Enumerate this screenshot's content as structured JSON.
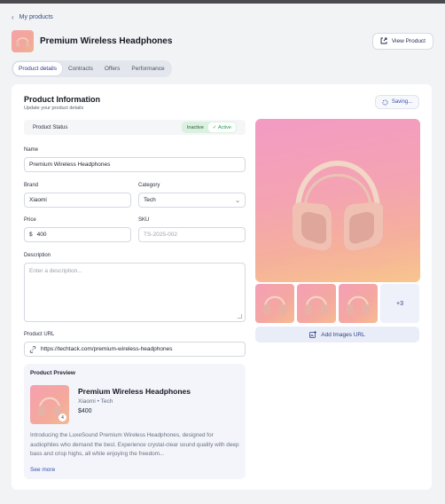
{
  "nav": {
    "back_label": "My products"
  },
  "header": {
    "title": "Premium Wireless Headphones",
    "view_button": "View Product"
  },
  "tabs": [
    {
      "label": "Product details",
      "active": true
    },
    {
      "label": "Contracts",
      "active": false
    },
    {
      "label": "Offers",
      "active": false
    },
    {
      "label": "Performance",
      "active": false
    }
  ],
  "info": {
    "title": "Product Information",
    "subtitle": "Update your product details",
    "saving_label": "Saving..."
  },
  "status": {
    "label": "Product Status",
    "inactive": "Inactive",
    "active": "Active",
    "selected": "Active"
  },
  "form": {
    "name_label": "Name",
    "name_value": "Premium Wireless Headphones",
    "brand_label": "Brand",
    "brand_value": "Xiaomi",
    "category_label": "Category",
    "category_value": "Tech",
    "price_label": "Price",
    "price_currency": "$",
    "price_value": "400",
    "sku_label": "SKU",
    "sku_placeholder": "TS-2025-002",
    "description_label": "Description",
    "description_placeholder": "Enter a description...",
    "url_label": "Product URL",
    "url_value": "https://techtack.com/premium-wireless-headphones"
  },
  "preview": {
    "title": "Product Preview",
    "name": "Premium Wireless Headphones",
    "meta": "Xiaomi • Tech",
    "price": "$400",
    "image_count": "4",
    "description": "Introducing the LuxeSound Premium Wireless Headphones, designed for audiophiles who demand the best. Experience crystal-clear sound quality with deep bass and crisp highs, all while enjoying the freedom...",
    "see_more": "See more"
  },
  "gallery": {
    "more_count": "+3",
    "add_url_label": "Add Images URL"
  },
  "colors": {
    "accent": "#3550b0",
    "active_green": "#239b4d"
  }
}
